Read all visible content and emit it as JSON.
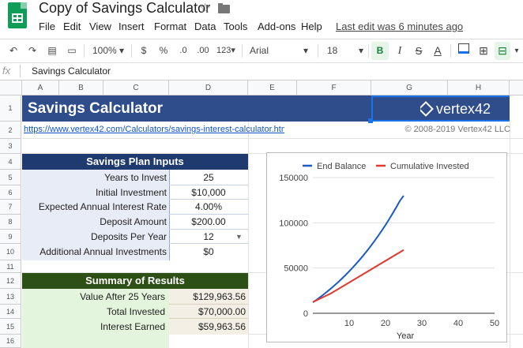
{
  "app": {
    "doc_title": "Copy of Savings Calculator",
    "last_edit": "Last edit was 6 minutes ago"
  },
  "menu": [
    "File",
    "Edit",
    "View",
    "Insert",
    "Format",
    "Data",
    "Tools",
    "Add-ons",
    "Help"
  ],
  "toolbar": {
    "zoom": "100%",
    "currency": "$",
    "percent": "%",
    "dec_less": ".0",
    "dec_more": ".00",
    "more_formats": "123",
    "font": "Arial",
    "font_size": "18",
    "bold": "B",
    "strike": "S",
    "text_color": "A"
  },
  "formula_bar": {
    "fx": "fx",
    "value": "Savings Calculator"
  },
  "columns": [
    "A",
    "B",
    "C",
    "D",
    "E",
    "F",
    "G",
    "H"
  ],
  "rows": [
    "1",
    "2",
    "3",
    "4",
    "5",
    "6",
    "7",
    "8",
    "9",
    "10",
    "11",
    "12",
    "13",
    "14",
    "15",
    "16"
  ],
  "sheet": {
    "title": "Savings Calculator",
    "brand": "vertex42",
    "link": "https://www.vertex42.com/Calculators/savings-interest-calculator.html",
    "copyright": "© 2008-2019 Vertex42 LLC",
    "inputs_header": "Savings Plan Inputs",
    "inputs": [
      {
        "label": "Years to Invest",
        "value": "25"
      },
      {
        "label": "Initial Investment",
        "value": "$10,000"
      },
      {
        "label": "Expected Annual Interest Rate",
        "value": "4.00%"
      },
      {
        "label": "Deposit Amount",
        "value": "$200.00"
      },
      {
        "label": "Deposits Per Year",
        "value": "12"
      },
      {
        "label": "Additional Annual Investments",
        "value": "$0"
      }
    ],
    "summary_header": "Summary of Results",
    "summary": [
      {
        "label": "Value After 25 Years",
        "value": "$129,963.56"
      },
      {
        "label": "Total Invested",
        "value": "$70,000.00"
      },
      {
        "label": "Interest Earned",
        "value": "$59,963.56"
      }
    ]
  },
  "colors": {
    "title_bg": "#2e4d8a",
    "inputs_bg": "#e8ecf6",
    "summary_header_bg": "#2d5016",
    "summary_bg": "#e3f5dc",
    "summary_value_bg": "#f3efe4",
    "end_balance": "#1a5bc7",
    "cumulative": "#e2382d"
  },
  "chart_data": {
    "type": "line",
    "xlabel": "Year",
    "xlim": [
      0,
      50
    ],
    "ylim": [
      0,
      150000
    ],
    "x_ticks": [
      10,
      20,
      30,
      40,
      50
    ],
    "y_ticks": [
      0,
      50000,
      100000,
      150000
    ],
    "legend_position": "top",
    "series": [
      {
        "name": "End Balance",
        "color": "#1a5bc7",
        "x": [
          0,
          1,
          2,
          3,
          4,
          5,
          6,
          7,
          8,
          9,
          10,
          11,
          12,
          13,
          14,
          15,
          16,
          17,
          18,
          19,
          20,
          21,
          22,
          23,
          24,
          25
        ],
        "values": [
          12000,
          14855,
          17826,
          20918,
          24136,
          27485,
          30970,
          34597,
          38372,
          42301,
          46390,
          50645,
          55074,
          59683,
          64479,
          69471,
          74666,
          80073,
          85699,
          91555,
          97649,
          103991,
          110591,
          117460,
          124609,
          129964
        ]
      },
      {
        "name": "Cumulative Invested",
        "color": "#e2382d",
        "x": [
          0,
          5,
          10,
          15,
          20,
          25
        ],
        "values": [
          12400,
          22000,
          34000,
          46000,
          58000,
          70000
        ]
      }
    ]
  }
}
